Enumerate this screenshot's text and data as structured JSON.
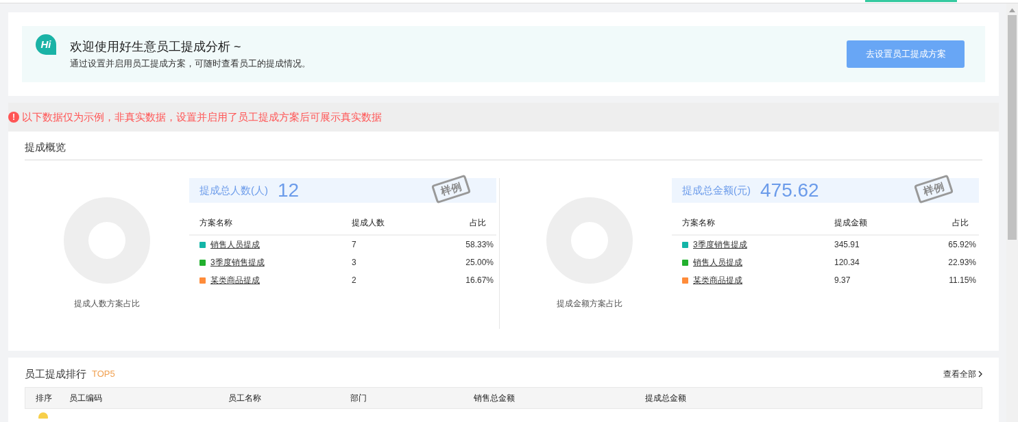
{
  "welcome": {
    "badge": "Hi",
    "title": "欢迎使用好生意员工提成分析 ~",
    "subtitle": "通过设置并启用员工提成方案，可随时查看员工的提成情况。",
    "button": "去设置员工提成方案"
  },
  "notice": {
    "icon": "!",
    "text": "以下数据仅为示例，非真实数据，设置并启用了员工提成方案后可展示真实数据"
  },
  "overview": {
    "title": "提成概览",
    "panels": [
      {
        "chart_caption": "提成人数方案占比",
        "total_label": "提成总人数(人)",
        "total_value": "12",
        "stamp": "样例",
        "columns": [
          "方案名称",
          "提成人数",
          "占比"
        ],
        "rows": [
          {
            "name": "销售人员提成",
            "value": "7",
            "share": "58.33%",
            "color": "#13b5a7"
          },
          {
            "name": "3季度销售提成",
            "value": "3",
            "share": "25.00%",
            "color": "#22b02e"
          },
          {
            "name": "某类商品提成",
            "value": "2",
            "share": "16.67%",
            "color": "#ff8c3a"
          }
        ]
      },
      {
        "chart_caption": "提成金额方案占比",
        "total_label": "提成总金额(元)",
        "total_value": "475.62",
        "stamp": "样例",
        "columns": [
          "方案名称",
          "提成金额",
          "占比"
        ],
        "rows": [
          {
            "name": "3季度销售提成",
            "value": "345.91",
            "share": "65.92%",
            "color": "#13b5a7"
          },
          {
            "name": "销售人员提成",
            "value": "120.34",
            "share": "22.93%",
            "color": "#22b02e"
          },
          {
            "name": "某类商品提成",
            "value": "9.37",
            "share": "11.15%",
            "color": "#ff8c3a"
          }
        ]
      }
    ]
  },
  "ranking": {
    "title": "员工提成排行",
    "tag": "TOP5",
    "view_all": "查看全部",
    "columns": [
      "排序",
      "员工编码",
      "员工名称",
      "部门",
      "销售总金额",
      "提成总金额"
    ]
  }
}
